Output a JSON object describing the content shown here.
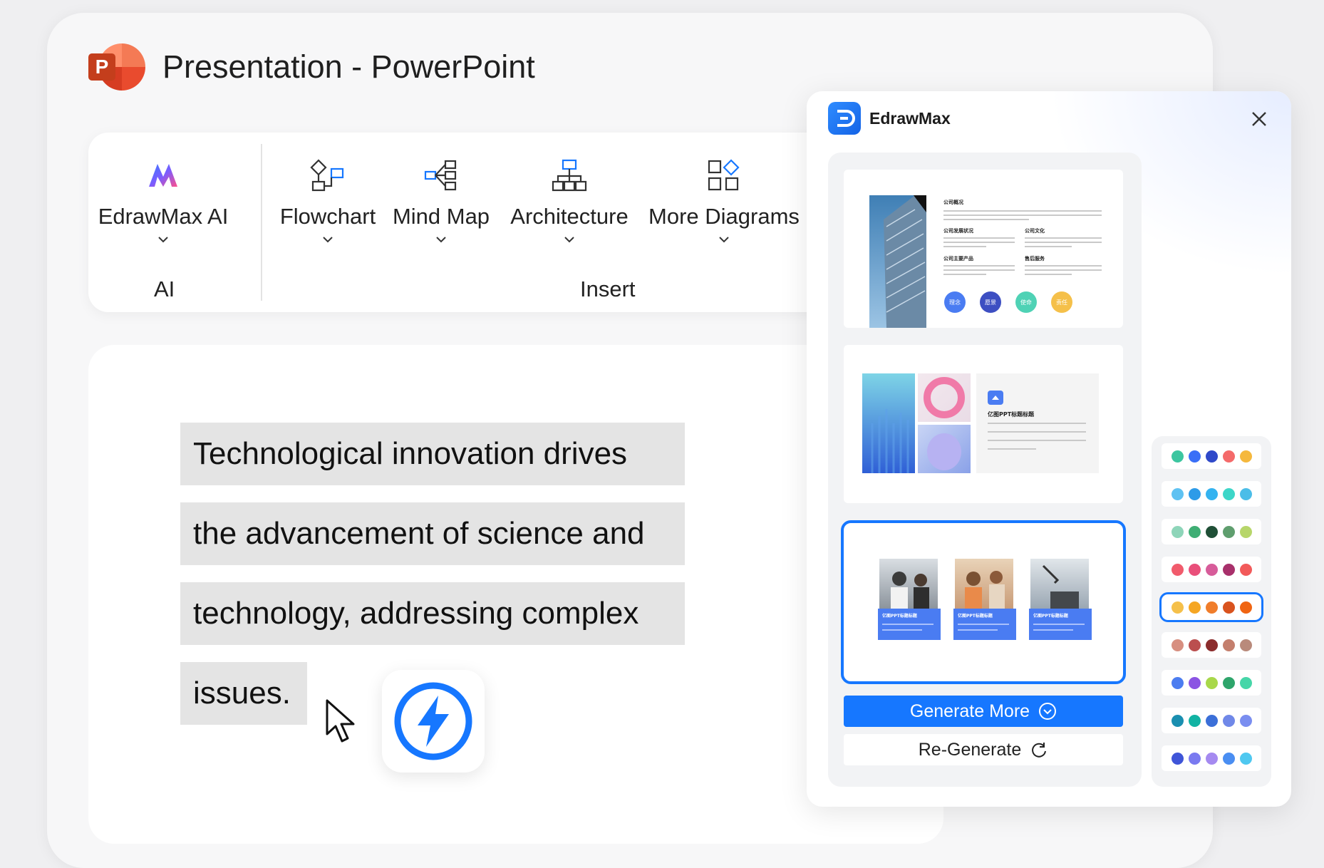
{
  "window": {
    "title": "Presentation - PowerPoint"
  },
  "ribbon": {
    "ai_group_label": "AI",
    "insert_group_label": "Insert",
    "buttons": [
      {
        "label": "EdrawMax AI",
        "icon": "edrawmax-ai-icon"
      },
      {
        "label": "Flowchart",
        "icon": "flowchart-icon"
      },
      {
        "label": "Mind Map",
        "icon": "mind-map-icon"
      },
      {
        "label": "Architecture",
        "icon": "architecture-icon"
      },
      {
        "label": "More Diagrams",
        "icon": "more-diagrams-icon"
      }
    ]
  },
  "slide": {
    "lines": [
      "Technological innovation drives",
      "the advancement of science and",
      "technology, addressing complex",
      "issues."
    ]
  },
  "panel": {
    "title": "EdrawMax",
    "generate_more": "Generate More",
    "regenerate": "Re-Generate",
    "templates": [
      {
        "headings": [
          "公司概况",
          "公司发展状况",
          "公司文化",
          "公司主要产品",
          "售后服务"
        ],
        "tags": [
          "理念",
          "愿景",
          "使命",
          "责任"
        ]
      },
      {
        "heading": "亿图PPT标题标题"
      },
      {
        "card_title": "亿图PPT标题标题",
        "selected": true
      }
    ],
    "palettes": [
      [
        "#3cc6a0",
        "#3a6ff7",
        "#2f49c9",
        "#f46a6a",
        "#f5b83d"
      ],
      [
        "#5fc2f2",
        "#2d9be8",
        "#34b3f0",
        "#3dd6c8",
        "#4bbde8"
      ],
      [
        "#8ed5b9",
        "#3fae74",
        "#1f4f36",
        "#5f9e6e",
        "#b7d66a"
      ],
      [
        "#f15b6c",
        "#e94f7a",
        "#d75c9a",
        "#a8306b",
        "#f25a5a"
      ],
      [
        "#f5c04a",
        "#f5a623",
        "#f07d2b",
        "#d9531e",
        "#f06512"
      ],
      [
        "#d78f80",
        "#bb4f4f",
        "#8b2c2c",
        "#c47f6d",
        "#b98a7b"
      ],
      [
        "#4c7df0",
        "#8b54e3",
        "#a8d84a",
        "#2ea56b",
        "#46d6a8"
      ],
      [
        "#1a8fb0",
        "#12b3a3",
        "#3b6fd8",
        "#7088e8",
        "#7a8ef0"
      ],
      [
        "#3f55d8",
        "#7a7af0",
        "#a58af0",
        "#4a8ef2",
        "#4fc8f0"
      ]
    ],
    "selected_palette_index": 4
  },
  "colors": {
    "accent": "#1677ff"
  }
}
